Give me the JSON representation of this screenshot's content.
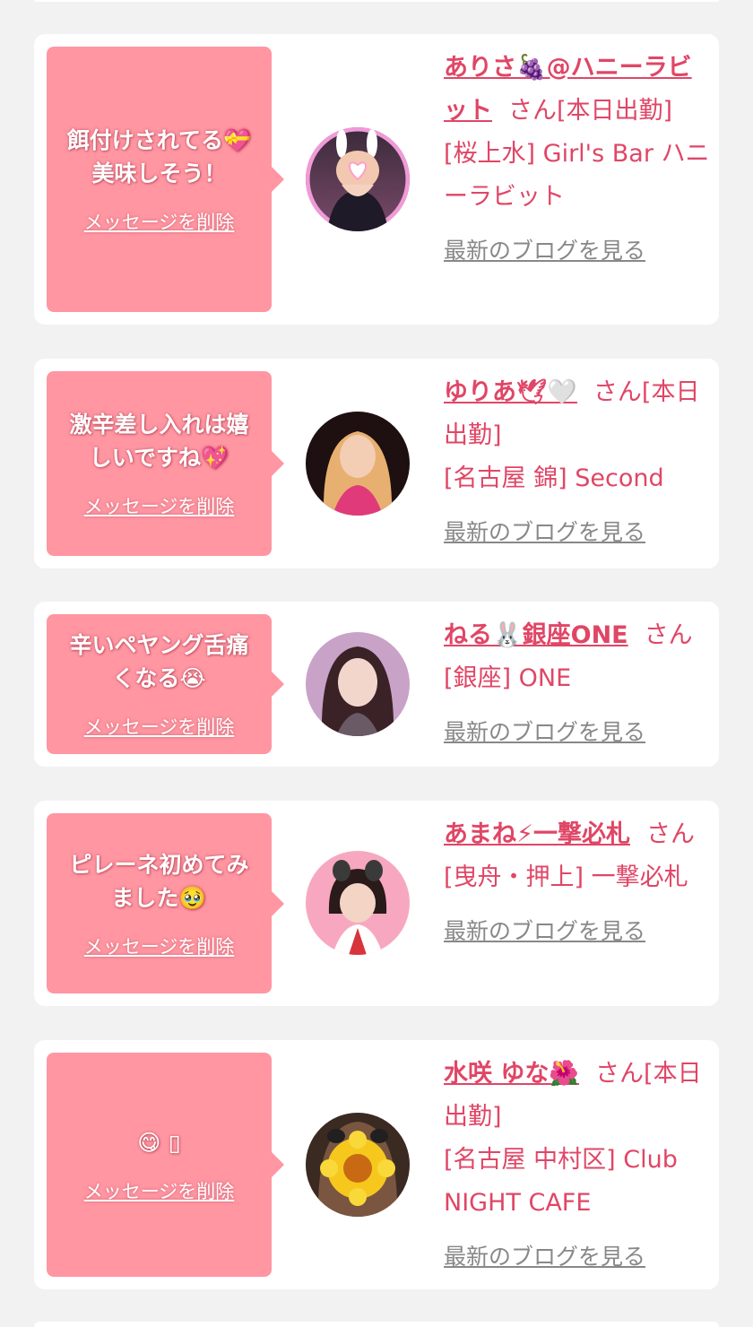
{
  "cards": [
    {
      "message": "餌付けされてる💝\n美味しそう！",
      "delete_label": "メッセージを削除",
      "name": "ありさ🍇@ハニーラビット",
      "san": "さん[本日出勤]",
      "shop": "[桜上水] Girl's Bar ハニーラビット",
      "blog_label": "最新のブログを見る"
    },
    {
      "message": "激辛差し入れは嬉\nしいですね💖",
      "delete_label": "メッセージを削除",
      "name": "ゆりあ🕊🤍",
      "san": "さん[本日出勤]",
      "shop": "[名古屋 錦] Second",
      "blog_label": "最新のブログを見る"
    },
    {
      "message": "辛いペヤング舌痛\nくなる😭",
      "delete_label": "メッセージを削除",
      "name": "ねる🐰銀座ONE",
      "san": "さん",
      "shop": "[銀座] ONE",
      "blog_label": "最新のブログを見る"
    },
    {
      "message": "ピレーネ初めてみ\nました🥹",
      "delete_label": "メッセージを削除",
      "name": "あまね⚡一撃必札",
      "san": "さん",
      "shop": "[曳舟・押上] 一撃必札",
      "blog_label": "最新のブログを見る"
    },
    {
      "message": "😋 ▯",
      "delete_label": "メッセージを削除",
      "name": "水咲 ゆな🌺",
      "san": "さん[本日出勤]",
      "shop": "[名古屋 中村区] Club NIGHT CAFE",
      "blog_label": "最新のブログを見る"
    }
  ],
  "colors": {
    "background": "#f2f2f2",
    "card": "#ffffff",
    "bubble": "#ff96a2",
    "accent_text": "#e04666",
    "link_gray": "#888888"
  },
  "icons": [
    "heart-icon",
    "flower-icon"
  ]
}
